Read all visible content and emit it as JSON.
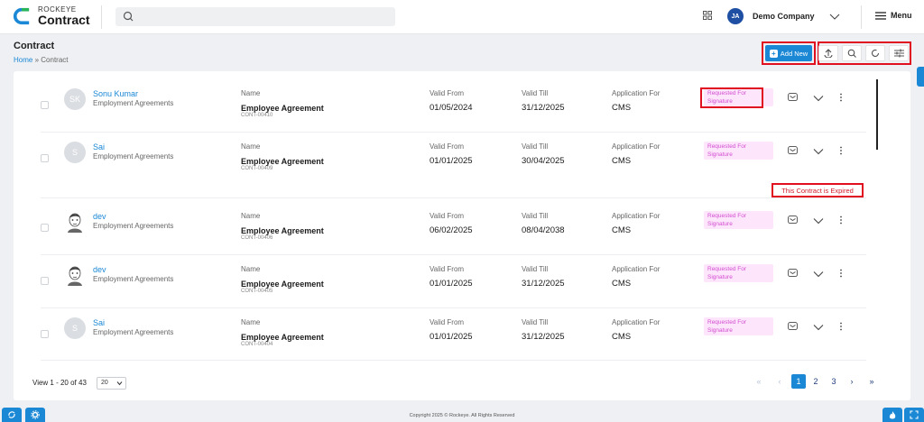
{
  "app": {
    "logo_top": "ROCKEYE",
    "logo_bottom": "Contract"
  },
  "header": {
    "avatar_initials": "JA",
    "company": "Demo Company",
    "menu_label": "Menu"
  },
  "page": {
    "title": "Contract",
    "breadcrumb_home": "Home",
    "breadcrumb_sep": "»",
    "breadcrumb_current": "Contract"
  },
  "toolbar": {
    "add_new_label": "Add New"
  },
  "labels": {
    "name": "Name",
    "valid_from": "Valid From",
    "valid_till": "Valid Till",
    "application_for": "Application For"
  },
  "rows": [
    {
      "initials": "SK",
      "person": "Sonu Kumar",
      "category": "Employment Agreements",
      "name": "Employee Agreement",
      "code": "CONT-00410",
      "valid_from": "01/05/2024",
      "valid_till": "31/12/2025",
      "application": "CMS",
      "status": "Requested For Signature",
      "photo": false
    },
    {
      "initials": "S",
      "person": "Sai",
      "category": "Employment Agreements",
      "name": "Employee Agreement",
      "code": "CONT-00409",
      "valid_from": "01/01/2025",
      "valid_till": "30/04/2025",
      "application": "CMS",
      "status": "Requested For Signature",
      "photo": false
    },
    {
      "initials": "",
      "person": "dev",
      "category": "Employment Agreements",
      "name": "Employee Agreement",
      "code": "CONT-00406",
      "valid_from": "06/02/2025",
      "valid_till": "08/04/2038",
      "application": "CMS",
      "status": "Requested For Signature",
      "photo": true
    },
    {
      "initials": "",
      "person": "dev",
      "category": "Employment Agreements",
      "name": "Employee Agreement",
      "code": "CONT-00405",
      "valid_from": "01/01/2025",
      "valid_till": "31/12/2025",
      "application": "CMS",
      "status": "Requested For Signature",
      "photo": true
    },
    {
      "initials": "S",
      "person": "Sai",
      "category": "Employment Agreements",
      "name": "Employee Agreement",
      "code": "CONT-00404",
      "valid_from": "01/01/2025",
      "valid_till": "31/12/2025",
      "application": "CMS",
      "status": "Requested For Signature",
      "photo": false
    }
  ],
  "tooltip": "This Contract is Expired",
  "pagination": {
    "view_text": "View 1 - 20 of 43",
    "page_size": "20",
    "pages": [
      "1",
      "2",
      "3"
    ],
    "first": "«",
    "prev": "‹",
    "next": "›",
    "last": "»",
    "current": "1"
  },
  "footer": {
    "copyright": "Copyright 2025 © Rockeye. All Rights Reserved"
  },
  "colors": {
    "accent": "#1b88d6",
    "status_bg": "#fde6fb",
    "status_text": "#d24cd1",
    "highlight": "#e01020"
  }
}
